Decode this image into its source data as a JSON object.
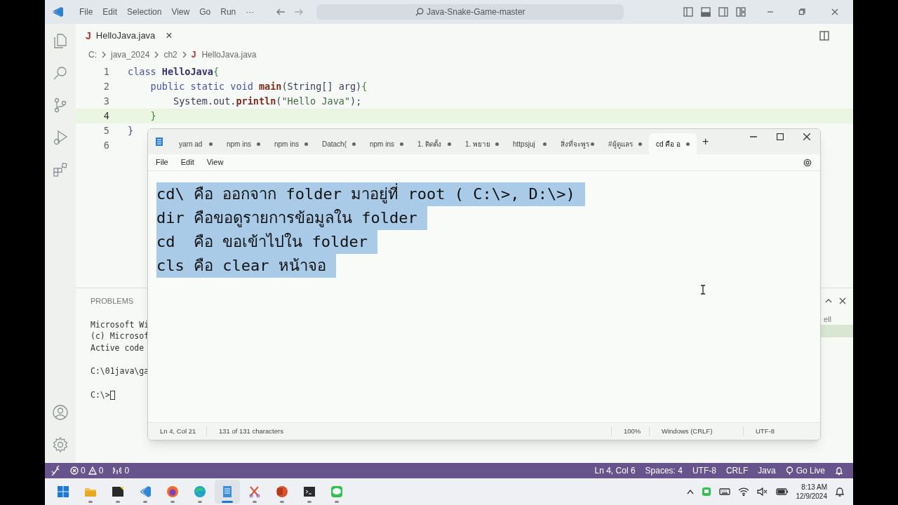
{
  "titlebar": {
    "menu": [
      "File",
      "Edit",
      "Selection",
      "View",
      "Go",
      "Run",
      "···"
    ],
    "search": "Java-Snake-Game-master"
  },
  "editor": {
    "tab": {
      "icon": "J",
      "label": "HelloJava.java",
      "close": "×"
    },
    "breadcrumb": [
      {
        "text": "C:"
      },
      {
        "text": "java_2024"
      },
      {
        "text": "ch2"
      },
      {
        "text": "HelloJava.java",
        "icon": "J"
      }
    ],
    "lines": [
      {
        "number": "1",
        "current": false,
        "tokens": [
          {
            "kind": "keyword",
            "text": "class "
          },
          {
            "kind": "type",
            "text": "HelloJava"
          },
          {
            "kind": "brace",
            "text": "{"
          }
        ]
      },
      {
        "number": "2",
        "current": false,
        "tokens": [
          {
            "kind": "keyword",
            "text": "    public static void "
          },
          {
            "kind": "method",
            "text": "main"
          },
          {
            "kind": "plain",
            "text": "(String[] arg)"
          },
          {
            "kind": "brace",
            "text": "{"
          }
        ]
      },
      {
        "number": "3",
        "current": false,
        "tokens": [
          {
            "kind": "plain",
            "text": "        System.out."
          },
          {
            "kind": "method",
            "text": "println"
          },
          {
            "kind": "plain",
            "text": "("
          },
          {
            "kind": "string",
            "text": "\"Hello Java\""
          },
          {
            "kind": "plain",
            "text": ");"
          }
        ]
      },
      {
        "number": "4",
        "current": true,
        "tokens": [
          {
            "kind": "brace",
            "text": "    }"
          }
        ]
      },
      {
        "number": "5",
        "current": false,
        "tokens": [
          {
            "kind": "brace2",
            "text": "}"
          }
        ]
      },
      {
        "number": "6",
        "current": false
      }
    ]
  },
  "panel": {
    "tab": "PROBLEMS",
    "terminal_blocks": [
      [
        "Microsoft Wi",
        "(c) Microsof",
        "Active code"
      ],
      [
        "C:\\01java\\ga"
      ],
      [
        "C:\\>"
      ]
    ],
    "side_text": "ell"
  },
  "notepad": {
    "tabs": [
      {
        "label": "yarn ad",
        "selected": false
      },
      {
        "label": "npm ins",
        "selected": false
      },
      {
        "label": "npm ins",
        "selected": false
      },
      {
        "label": "Datach(",
        "selected": false
      },
      {
        "label": "npm ins",
        "selected": false
      },
      {
        "label": "1. ติดตั้ง",
        "selected": false
      },
      {
        "label": "1. พยาย",
        "selected": false
      },
      {
        "label": "httpsjuj",
        "selected": false
      },
      {
        "label": "สิ่งที่จะพูร",
        "selected": false
      },
      {
        "label": "#ผู้ดูแลร",
        "selected": false
      },
      {
        "label": "cd คือ อ",
        "selected": true
      }
    ],
    "new_tab": "+",
    "menu": [
      "File",
      "Edit",
      "View"
    ],
    "lines": [
      "cd\\ คือ ออกจาก folder มาอยู่ที่ root ( C:\\>, D:\\>)",
      "dir คือขอดูรายการข้อมูลใน folder",
      "cd  คือ ขอเข้าไปใน folder",
      "cls คือ clear หน้าจอ"
    ],
    "status": [
      "Ln 4, Col 21",
      "131 of 131 characters",
      "100%",
      "Windows (CRLF)",
      "UTF-8"
    ]
  },
  "status_bar": {
    "errors": "0",
    "warnings": "0",
    "ports": "0",
    "right": [
      "Ln 4, Col 6",
      "Spaces: 4",
      "UTF-8",
      "CRLF",
      "Java",
      "Go Live"
    ]
  },
  "taskbar": {
    "apps": [
      {
        "kind": "start",
        "selected": false
      },
      {
        "kind": "folder",
        "selected": false
      },
      {
        "kind": "notes",
        "selected": false
      },
      {
        "kind": "code",
        "selected": false
      },
      {
        "kind": "firefox",
        "selected": false
      },
      {
        "kind": "edge",
        "selected": false
      },
      {
        "kind": "notepad",
        "selected": true
      },
      {
        "kind": "snip",
        "selected": false
      },
      {
        "kind": "slides",
        "selected": false
      },
      {
        "kind": "terminal",
        "selected": false
      },
      {
        "kind": "chat",
        "selected": false
      }
    ],
    "time": "8:13 AM",
    "date": "12/9/2024"
  }
}
